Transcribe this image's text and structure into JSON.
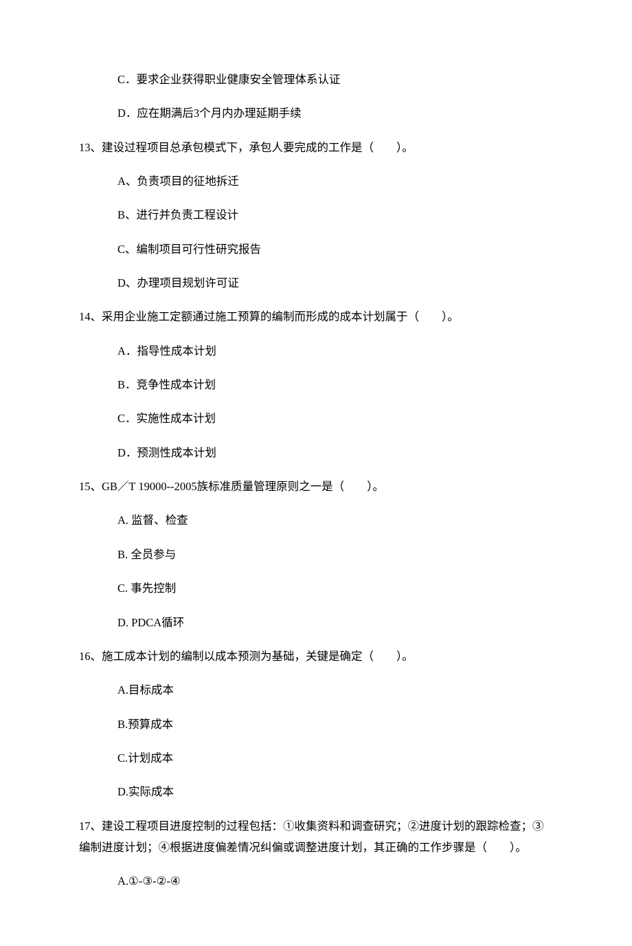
{
  "orphan_options": {
    "c": "C．要求企业获得职业健康安全管理体系认证",
    "d": "D．应在期满后3个月内办理延期手续"
  },
  "questions": [
    {
      "number": "13、",
      "text": "建设过程项目总承包模式下，承包人要完成的工作是（　　）。",
      "options": [
        "A、负责项目的征地拆迁",
        "B、进行并负责工程设计",
        "C、编制项目可行性研究报告",
        "D、办理项目规划许可证"
      ]
    },
    {
      "number": "14、",
      "text": "采用企业施工定额通过施工预算的编制而形成的成本计划属于（　　）。",
      "options": [
        "A．指导性成本计划",
        "B．竞争性成本计划",
        "C．实施性成本计划",
        "D．预测性成本计划"
      ]
    },
    {
      "number": "15、",
      "text": "GB／T 19000--2005族标准质量管理原则之一是（　　）。",
      "options": [
        "A. 监督、检查",
        "B. 全员参与",
        "C. 事先控制",
        "D. PDCA循环"
      ]
    },
    {
      "number": "16、",
      "text": "施工成本计划的编制以成本预测为基础，关键是确定（　　）。",
      "options": [
        "A.目标成本",
        "B.预算成本",
        "C.计划成本",
        "D.实际成本"
      ]
    },
    {
      "number": "17、",
      "text": "建设工程项目进度控制的过程包括：①收集资料和调查研究；②进度计划的跟踪检查；③编制进度计划；④根据进度偏差情况纠偏或调整进度计划，其正确的工作步骤是（　　）。",
      "options": [
        "A.①-③-②-④"
      ]
    }
  ]
}
